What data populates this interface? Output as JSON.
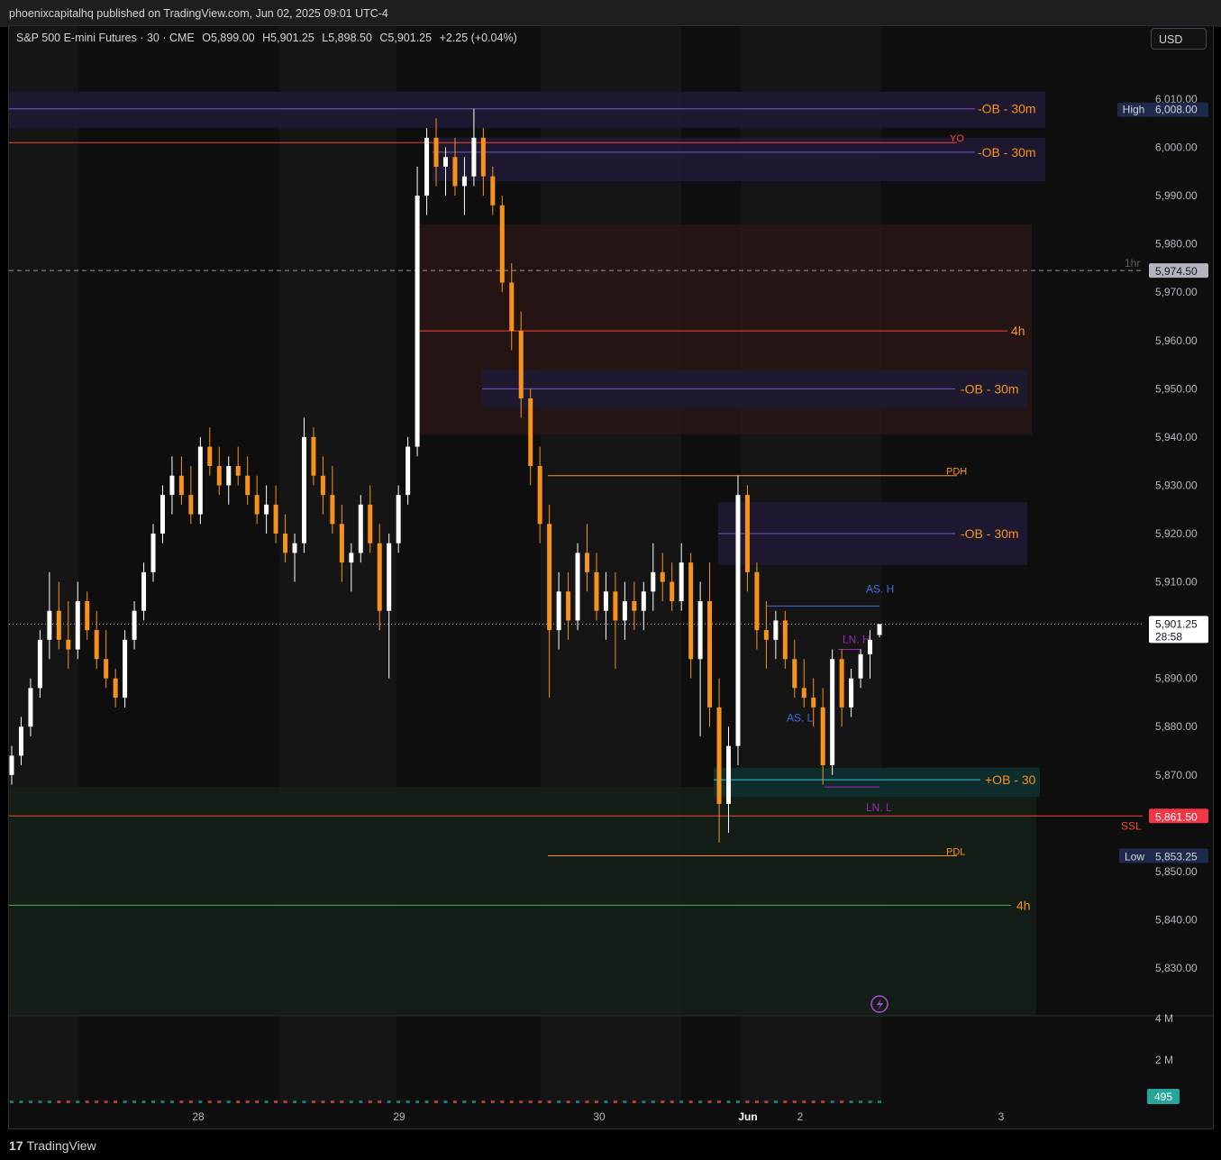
{
  "publisher_line": "phoenixcapitalhq published on TradingView.com, Jun 02, 2025 09:01 UTC-4",
  "legend": {
    "symbol": "S&P 500 E-mini Futures · 30 · CME",
    "open": "O5,899.00",
    "high": "H5,901.25",
    "low": "L5,898.50",
    "close": "C5,901.25",
    "change": "+2.25 (+0.04%)"
  },
  "currency_button": "USD",
  "footer_brand": "TradingView",
  "colors": {
    "bull": "#ffffff",
    "bear": "#f7931a",
    "ob_bear_zone": "#1f1a33",
    "htf_bear_zone": "#2a1616",
    "htf_bull_zone": "#142016",
    "ob_bull_zone": "#0f2e2e"
  },
  "chart_data": {
    "type": "candlestick",
    "title": "S&P 500 E-mini Futures · 30 · CME",
    "y_axis": {
      "range": [
        5823,
        6017
      ],
      "ticks": [
        "6,010.00",
        "6,000.00",
        "5,990.00",
        "5,980.00",
        "5,970.00",
        "5,960.00",
        "5,950.00",
        "5,940.00",
        "5,930.00",
        "5,920.00",
        "5,910.00",
        "5,890.00",
        "5,880.00",
        "5,870.00",
        "5,850.00",
        "5,840.00",
        "5,830.00"
      ]
    },
    "x_axis": {
      "ticks": [
        "28",
        "29",
        "30",
        "Jun",
        "2",
        "3"
      ]
    },
    "price_badges": [
      {
        "label": "High",
        "value": "6,008.00",
        "price": 6008.0
      },
      {
        "label": "1hr",
        "value": "5,974.50",
        "price": 5974.5
      },
      {
        "label": "",
        "value": "5,901.25",
        "sub": "28:58",
        "price": 5901.25
      },
      {
        "label": "SSL",
        "value": "5,861.50",
        "price": 5861.5
      },
      {
        "label": "Low",
        "value": "5,853.25",
        "price": 5853.25
      }
    ],
    "volume_axis": [
      "4 M",
      "2 M"
    ],
    "volume_badge": "495",
    "levels": [
      {
        "label": "-OB - 30m",
        "price": 6008.0
      },
      {
        "label": "YO",
        "price": 6001.0
      },
      {
        "label": "-OB - 30m",
        "price": 5999.0
      },
      {
        "label": "4h",
        "price": 5962.0
      },
      {
        "label": "-OB - 30m",
        "price": 5950.0
      },
      {
        "label": "PDH",
        "price": 5932.0
      },
      {
        "label": "-OB - 30m",
        "price": 5920.0
      },
      {
        "label": "AS. H",
        "price": 5905.0
      },
      {
        "label": "LN. H",
        "price": 5896.0
      },
      {
        "label": "AS. L",
        "price": 5882.0
      },
      {
        "label": "+OB - 30",
        "price": 5869.0
      },
      {
        "label": "LN. L",
        "price": 5867.5
      },
      {
        "label": "PDL",
        "price": 5853.25
      },
      {
        "label": "4h",
        "price": 5843.0
      }
    ],
    "series": [
      {
        "name": "ES 30m",
        "ohlc": [
          [
            5870,
            5876,
            5868,
            5874
          ],
          [
            5874,
            5882,
            5872,
            5880
          ],
          [
            5880,
            5890,
            5878,
            5888
          ],
          [
            5888,
            5900,
            5886,
            5898
          ],
          [
            5898,
            5912,
            5894,
            5904
          ],
          [
            5904,
            5910,
            5896,
            5898
          ],
          [
            5898,
            5906,
            5892,
            5896
          ],
          [
            5896,
            5910,
            5894,
            5906
          ],
          [
            5906,
            5908,
            5898,
            5900
          ],
          [
            5900,
            5904,
            5892,
            5894
          ],
          [
            5894,
            5900,
            5888,
            5890
          ],
          [
            5890,
            5892,
            5884,
            5886
          ],
          [
            5886,
            5900,
            5884,
            5898
          ],
          [
            5898,
            5906,
            5896,
            5904
          ],
          [
            5904,
            5914,
            5902,
            5912
          ],
          [
            5912,
            5922,
            5910,
            5920
          ],
          [
            5920,
            5930,
            5918,
            5928
          ],
          [
            5928,
            5936,
            5924,
            5932
          ],
          [
            5932,
            5936,
            5926,
            5928
          ],
          [
            5928,
            5934,
            5922,
            5924
          ],
          [
            5924,
            5940,
            5922,
            5938
          ],
          [
            5938,
            5942,
            5932,
            5934
          ],
          [
            5934,
            5938,
            5928,
            5930
          ],
          [
            5930,
            5936,
            5926,
            5934
          ],
          [
            5934,
            5938,
            5930,
            5932
          ],
          [
            5932,
            5936,
            5926,
            5928
          ],
          [
            5928,
            5932,
            5922,
            5924
          ],
          [
            5924,
            5930,
            5920,
            5926
          ],
          [
            5926,
            5930,
            5918,
            5920
          ],
          [
            5920,
            5924,
            5914,
            5916
          ],
          [
            5916,
            5920,
            5910,
            5918
          ],
          [
            5918,
            5944,
            5916,
            5940
          ],
          [
            5940,
            5942,
            5930,
            5932
          ],
          [
            5932,
            5936,
            5924,
            5928
          ],
          [
            5928,
            5934,
            5920,
            5922
          ],
          [
            5922,
            5926,
            5910,
            5914
          ],
          [
            5914,
            5918,
            5908,
            5916
          ],
          [
            5916,
            5928,
            5914,
            5926
          ],
          [
            5926,
            5930,
            5916,
            5918
          ],
          [
            5918,
            5922,
            5900,
            5904
          ],
          [
            5904,
            5920,
            5890,
            5918
          ],
          [
            5918,
            5930,
            5916,
            5928
          ],
          [
            5928,
            5940,
            5926,
            5938
          ],
          [
            5938,
            5996,
            5936,
            5990
          ],
          [
            5990,
            6004,
            5986,
            6002
          ],
          [
            6002,
            6006,
            5992,
            5996
          ],
          [
            5996,
            6000,
            5990,
            5998
          ],
          [
            5998,
            6002,
            5990,
            5992
          ],
          [
            5992,
            5998,
            5986,
            5994
          ],
          [
            5994,
            6008,
            5992,
            6002
          ],
          [
            6002,
            6004,
            5990,
            5994
          ],
          [
            5994,
            5996,
            5986,
            5988
          ],
          [
            5988,
            5990,
            5970,
            5972
          ],
          [
            5972,
            5976,
            5958,
            5962
          ],
          [
            5962,
            5966,
            5944,
            5948
          ],
          [
            5948,
            5950,
            5930,
            5934
          ],
          [
            5934,
            5938,
            5918,
            5922
          ],
          [
            5922,
            5926,
            5886,
            5900
          ],
          [
            5900,
            5912,
            5896,
            5908
          ],
          [
            5908,
            5912,
            5898,
            5902
          ],
          [
            5902,
            5918,
            5900,
            5916
          ],
          [
            5916,
            5922,
            5908,
            5912
          ],
          [
            5912,
            5916,
            5902,
            5904
          ],
          [
            5904,
            5912,
            5898,
            5908
          ],
          [
            5908,
            5912,
            5892,
            5902
          ],
          [
            5902,
            5910,
            5898,
            5906
          ],
          [
            5906,
            5910,
            5900,
            5904
          ],
          [
            5904,
            5910,
            5900,
            5908
          ],
          [
            5908,
            5918,
            5904,
            5912
          ],
          [
            5912,
            5916,
            5906,
            5910
          ],
          [
            5910,
            5914,
            5904,
            5906
          ],
          [
            5906,
            5918,
            5904,
            5914
          ],
          [
            5914,
            5916,
            5890,
            5894
          ],
          [
            5894,
            5910,
            5878,
            5906
          ],
          [
            5906,
            5914,
            5880,
            5884
          ],
          [
            5884,
            5890,
            5856,
            5864
          ],
          [
            5864,
            5880,
            5858,
            5876
          ],
          [
            5876,
            5932,
            5872,
            5928
          ],
          [
            5928,
            5930,
            5908,
            5912
          ],
          [
            5912,
            5914,
            5896,
            5900
          ],
          [
            5900,
            5906,
            5892,
            5898
          ],
          [
            5898,
            5904,
            5894,
            5902
          ],
          [
            5902,
            5904,
            5892,
            5894
          ],
          [
            5894,
            5898,
            5886,
            5888
          ],
          [
            5888,
            5894,
            5884,
            5886
          ],
          [
            5886,
            5890,
            5880,
            5884
          ],
          [
            5884,
            5888,
            5868,
            5872
          ],
          [
            5872,
            5896,
            5870,
            5894
          ],
          [
            5894,
            5896,
            5880,
            5884
          ],
          [
            5884,
            5892,
            5882,
            5890
          ],
          [
            5890,
            5896,
            5888,
            5895
          ],
          [
            5895,
            5900,
            5890,
            5898
          ],
          [
            5899,
            5901.25,
            5898.5,
            5901.25
          ]
        ]
      }
    ]
  }
}
